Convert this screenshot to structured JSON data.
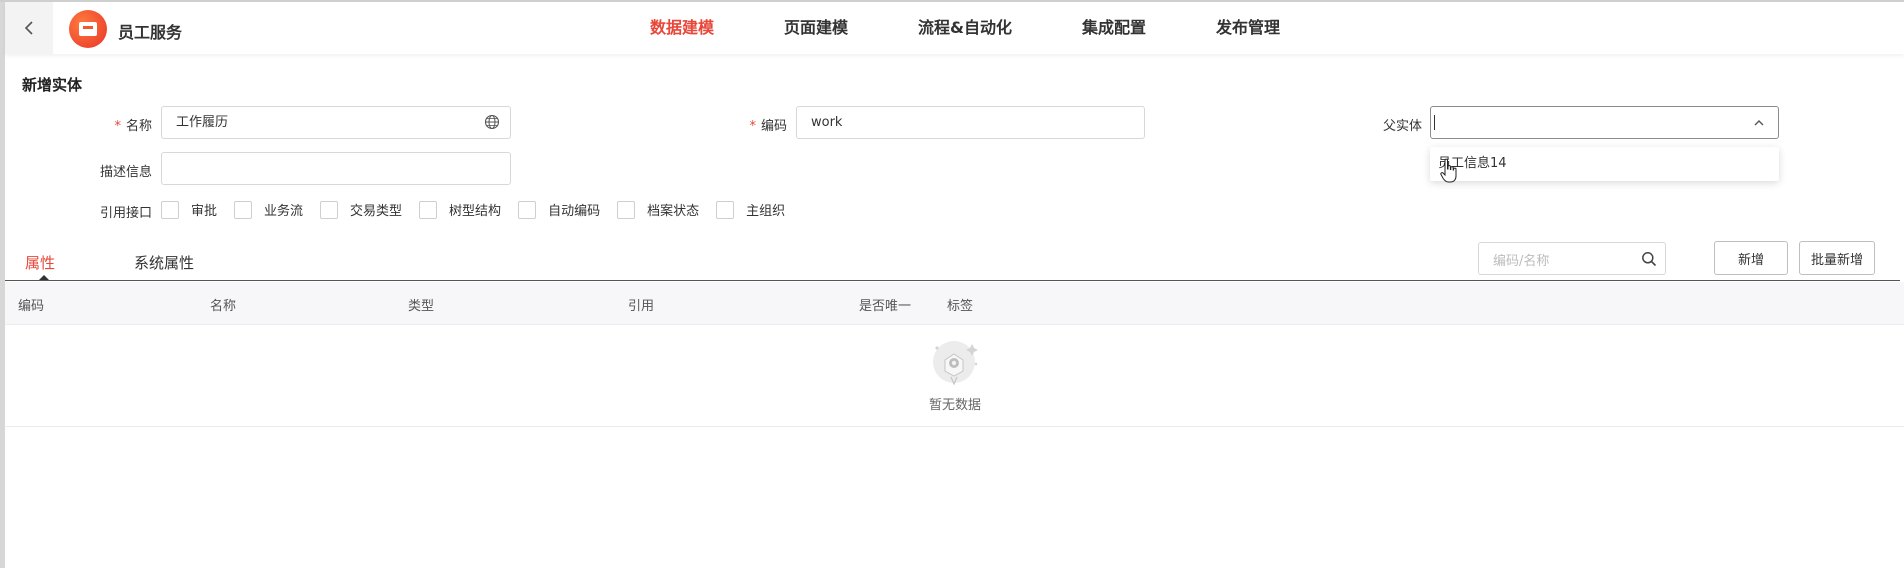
{
  "header": {
    "app_name": "员工服务",
    "nav": [
      "数据建模",
      "页面建模",
      "流程&自动化",
      "集成配置",
      "发布管理"
    ],
    "active_nav": "数据建模"
  },
  "form": {
    "title": "新增实体",
    "name_label": "名称",
    "name_value": "工作履历",
    "code_label": "编码",
    "code_value": "work",
    "parent_label": "父实体",
    "parent_value": "",
    "parent_options": [
      "员工信息14"
    ],
    "desc_label": "描述信息",
    "desc_value": "",
    "interfaces_label": "引用接口",
    "interfaces": [
      "审批",
      "业务流",
      "交易类型",
      "树型结构",
      "自动编码",
      "档案状态",
      "主组织"
    ]
  },
  "tabs": {
    "items": [
      "属性",
      "系统属性"
    ],
    "active": "属性"
  },
  "toolbar": {
    "search_placeholder": "编码/名称",
    "add_label": "新增",
    "batch_add_label": "批量新增"
  },
  "table": {
    "columns": [
      "编码",
      "名称",
      "类型",
      "引用",
      "是否唯一",
      "标签"
    ],
    "rows": [],
    "empty_text": "暂无数据"
  },
  "colors": {
    "accent": "#e8473a",
    "border": "#d8d8d8",
    "header_bg": "#f7f7f9"
  }
}
